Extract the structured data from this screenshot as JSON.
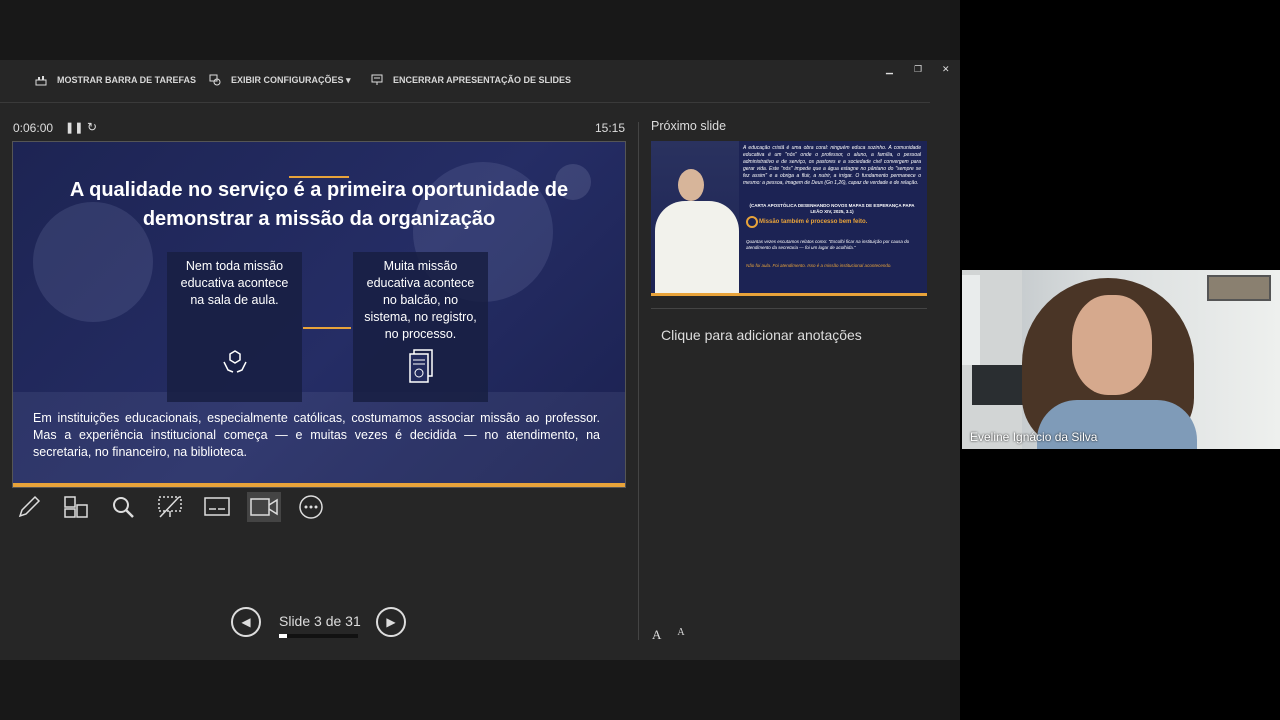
{
  "toolbar": {
    "show_taskbar": "MOSTRAR BARRA DE TAREFAS",
    "display_settings": "EXIBIR CONFIGURAÇÕES ▾",
    "end_show": "ENCERRAR APRESENTAÇÃO DE SLIDES"
  },
  "window_controls": {
    "minimize": "▁",
    "restore": "❐",
    "close": "✕"
  },
  "timer": {
    "elapsed": "0:06:00",
    "clock": "15:15"
  },
  "slide": {
    "title": "A qualidade no serviço é a primeira oportunidade de demonstrar a missão da organização",
    "card_left": "Nem toda missão educativa acontece na sala de aula.",
    "card_right": "Muita missão educativa acontece no balcão, no sistema, no registro, no processo.",
    "body": "Em instituições educacionais, especialmente católicas, costumamos associar missão ao professor. Mas a experiência institucional começa — e muitas vezes é decidida — no atendimento, na secretaria, no financeiro, na biblioteca."
  },
  "navigation": {
    "slide_counter": "Slide 3 de 31",
    "current": 3,
    "total": 31
  },
  "next_slide": {
    "label": "Próximo slide",
    "text": "A educação cristã é uma obra coral: ninguém educa sozinho. A comunidade educativa é um \"nós\" onde o professor, o aluno, a família, o pessoal administrativo e de serviço, os pastores e a sociedade civil convergem para gerar vida. Este \"nós\" impede que a água estagne no pântano do \"sempre se fez assim\" e a obriga a fluir, a nutrir, a irrigar. O fundamento permanece o mesmo: a pessoa, imagem de Deus (Gn 1,26), capaz de verdade e de relação.",
    "citation": "(CARTA APOSTÓLICA DESENHANDO NOVOS MAPAS DE ESPERANÇA PAPA LEÃO XIV, 2025, 3.1)",
    "mission": "Missão também é processo bem feito.",
    "quote": "Quantas vezes escutamos relatos como: \"Escolhi ficar na instituição por causa do atendimento da secretaria — foi um lugar de acolhida.\"",
    "final": "Não foi aula. Foi atendimento. Isso é a missão institucional acontecendo."
  },
  "notes": {
    "placeholder": "Clique para adicionar anotações"
  },
  "font_controls": {
    "increase": "A",
    "decrease": "A"
  },
  "video": {
    "participant_name": "Eveline Ignácio da Silva"
  },
  "colors": {
    "slide_bg": "#1d2453",
    "accent": "#e8a33a",
    "presenter_bg": "#262626"
  }
}
